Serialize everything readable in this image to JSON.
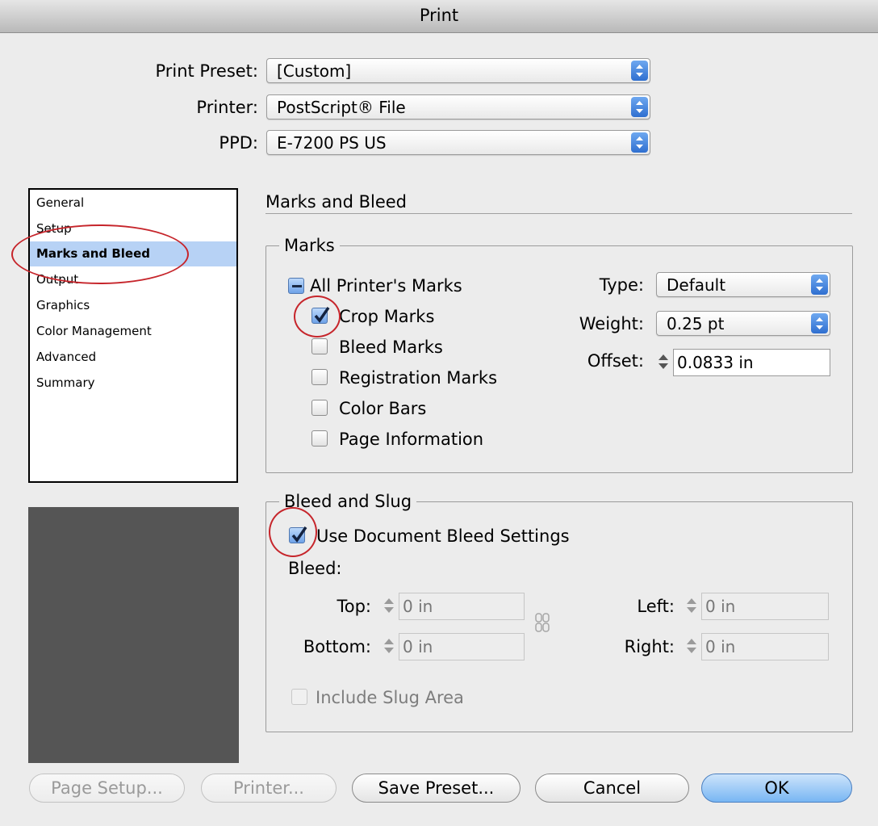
{
  "window": {
    "title": "Print"
  },
  "top": {
    "preset_label": "Print Preset:",
    "preset_value": "[Custom]",
    "printer_label": "Printer:",
    "printer_value": "PostScript® File",
    "ppd_label": "PPD:",
    "ppd_value": "E-7200 PS US"
  },
  "sidebar": {
    "items": [
      "General",
      "Setup",
      "Marks and Bleed",
      "Output",
      "Graphics",
      "Color Management",
      "Advanced",
      "Summary"
    ],
    "selected": "Marks and Bleed"
  },
  "panel": {
    "title": "Marks and Bleed"
  },
  "marks": {
    "legend": "Marks",
    "all_label": "All Printer's Marks",
    "crop_label": "Crop Marks",
    "crop_checked": true,
    "bleed_label": "Bleed Marks",
    "registration_label": "Registration Marks",
    "colorbars_label": "Color Bars",
    "pageinfo_label": "Page Information",
    "type_label": "Type:",
    "type_value": "Default",
    "weight_label": "Weight:",
    "weight_value": "0.25 pt",
    "offset_label": "Offset:",
    "offset_value": "0.0833 in"
  },
  "bleedslug": {
    "legend": "Bleed and Slug",
    "use_doc_label": "Use Document Bleed Settings",
    "use_doc_checked": true,
    "bleed_label": "Bleed:",
    "top_label": "Top:",
    "top_value": "0 in",
    "bottom_label": "Bottom:",
    "bottom_value": "0 in",
    "left_label": "Left:",
    "left_value": "0 in",
    "right_label": "Right:",
    "right_value": "0 in",
    "slug_label": "Include Slug Area"
  },
  "buttons": {
    "page_setup": "Page Setup...",
    "printer": "Printer...",
    "save_preset": "Save Preset...",
    "cancel": "Cancel",
    "ok": "OK"
  },
  "colors": {
    "selection": "#b7d2f5",
    "annotation": "#c6252b",
    "default_button": "#78b6f3"
  }
}
